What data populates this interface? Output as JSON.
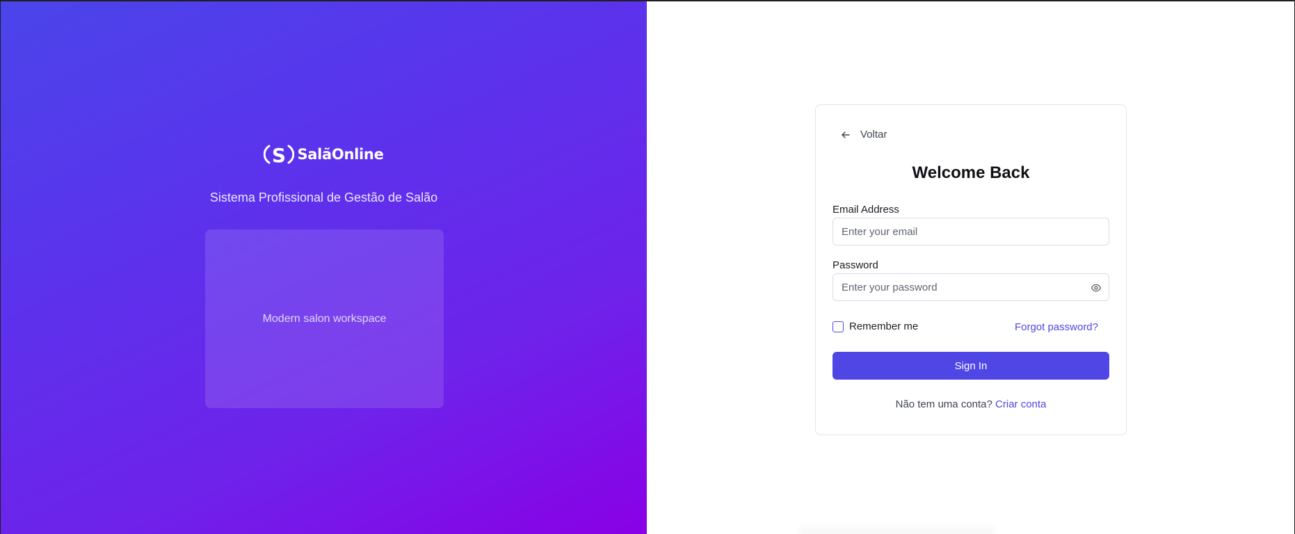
{
  "brand": {
    "name": "SalãOnline",
    "tagline": "Sistema Profissional de Gestão de Salão",
    "image_placeholder": "Modern salon workspace"
  },
  "login": {
    "back_label": "Voltar",
    "title": "Welcome Back",
    "email": {
      "label": "Email Address",
      "placeholder": "Enter your email",
      "value": ""
    },
    "password": {
      "label": "Password",
      "placeholder": "Enter your password",
      "value": ""
    },
    "remember_label": "Remember me",
    "remember_checked": false,
    "forgot_label": "Forgot password?",
    "submit_label": "Sign In",
    "signup_prompt": "Não tem uma conta?",
    "signup_link": "Criar conta"
  },
  "colors": {
    "accent": "#4f46e5",
    "gradient_start": "#4a45ea",
    "gradient_end": "#8a00e6"
  },
  "icons": [
    "logo-s-icon",
    "arrow-left-icon",
    "eye-icon"
  ]
}
